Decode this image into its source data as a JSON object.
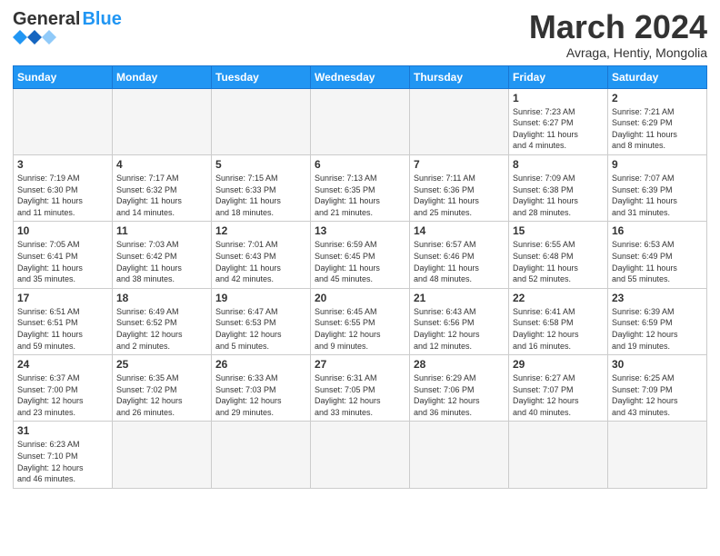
{
  "logo": {
    "general": "General",
    "blue": "Blue"
  },
  "header": {
    "month": "March 2024",
    "location": "Avraga, Hentiy, Mongolia"
  },
  "days": [
    "Sunday",
    "Monday",
    "Tuesday",
    "Wednesday",
    "Thursday",
    "Friday",
    "Saturday"
  ],
  "weeks": [
    [
      {
        "num": "",
        "info": ""
      },
      {
        "num": "",
        "info": ""
      },
      {
        "num": "",
        "info": ""
      },
      {
        "num": "",
        "info": ""
      },
      {
        "num": "",
        "info": ""
      },
      {
        "num": "1",
        "info": "Sunrise: 7:23 AM\nSunset: 6:27 PM\nDaylight: 11 hours\nand 4 minutes."
      },
      {
        "num": "2",
        "info": "Sunrise: 7:21 AM\nSunset: 6:29 PM\nDaylight: 11 hours\nand 8 minutes."
      }
    ],
    [
      {
        "num": "3",
        "info": "Sunrise: 7:19 AM\nSunset: 6:30 PM\nDaylight: 11 hours\nand 11 minutes."
      },
      {
        "num": "4",
        "info": "Sunrise: 7:17 AM\nSunset: 6:32 PM\nDaylight: 11 hours\nand 14 minutes."
      },
      {
        "num": "5",
        "info": "Sunrise: 7:15 AM\nSunset: 6:33 PM\nDaylight: 11 hours\nand 18 minutes."
      },
      {
        "num": "6",
        "info": "Sunrise: 7:13 AM\nSunset: 6:35 PM\nDaylight: 11 hours\nand 21 minutes."
      },
      {
        "num": "7",
        "info": "Sunrise: 7:11 AM\nSunset: 6:36 PM\nDaylight: 11 hours\nand 25 minutes."
      },
      {
        "num": "8",
        "info": "Sunrise: 7:09 AM\nSunset: 6:38 PM\nDaylight: 11 hours\nand 28 minutes."
      },
      {
        "num": "9",
        "info": "Sunrise: 7:07 AM\nSunset: 6:39 PM\nDaylight: 11 hours\nand 31 minutes."
      }
    ],
    [
      {
        "num": "10",
        "info": "Sunrise: 7:05 AM\nSunset: 6:41 PM\nDaylight: 11 hours\nand 35 minutes."
      },
      {
        "num": "11",
        "info": "Sunrise: 7:03 AM\nSunset: 6:42 PM\nDaylight: 11 hours\nand 38 minutes."
      },
      {
        "num": "12",
        "info": "Sunrise: 7:01 AM\nSunset: 6:43 PM\nDaylight: 11 hours\nand 42 minutes."
      },
      {
        "num": "13",
        "info": "Sunrise: 6:59 AM\nSunset: 6:45 PM\nDaylight: 11 hours\nand 45 minutes."
      },
      {
        "num": "14",
        "info": "Sunrise: 6:57 AM\nSunset: 6:46 PM\nDaylight: 11 hours\nand 48 minutes."
      },
      {
        "num": "15",
        "info": "Sunrise: 6:55 AM\nSunset: 6:48 PM\nDaylight: 11 hours\nand 52 minutes."
      },
      {
        "num": "16",
        "info": "Sunrise: 6:53 AM\nSunset: 6:49 PM\nDaylight: 11 hours\nand 55 minutes."
      }
    ],
    [
      {
        "num": "17",
        "info": "Sunrise: 6:51 AM\nSunset: 6:51 PM\nDaylight: 11 hours\nand 59 minutes."
      },
      {
        "num": "18",
        "info": "Sunrise: 6:49 AM\nSunset: 6:52 PM\nDaylight: 12 hours\nand 2 minutes."
      },
      {
        "num": "19",
        "info": "Sunrise: 6:47 AM\nSunset: 6:53 PM\nDaylight: 12 hours\nand 5 minutes."
      },
      {
        "num": "20",
        "info": "Sunrise: 6:45 AM\nSunset: 6:55 PM\nDaylight: 12 hours\nand 9 minutes."
      },
      {
        "num": "21",
        "info": "Sunrise: 6:43 AM\nSunset: 6:56 PM\nDaylight: 12 hours\nand 12 minutes."
      },
      {
        "num": "22",
        "info": "Sunrise: 6:41 AM\nSunset: 6:58 PM\nDaylight: 12 hours\nand 16 minutes."
      },
      {
        "num": "23",
        "info": "Sunrise: 6:39 AM\nSunset: 6:59 PM\nDaylight: 12 hours\nand 19 minutes."
      }
    ],
    [
      {
        "num": "24",
        "info": "Sunrise: 6:37 AM\nSunset: 7:00 PM\nDaylight: 12 hours\nand 23 minutes."
      },
      {
        "num": "25",
        "info": "Sunrise: 6:35 AM\nSunset: 7:02 PM\nDaylight: 12 hours\nand 26 minutes."
      },
      {
        "num": "26",
        "info": "Sunrise: 6:33 AM\nSunset: 7:03 PM\nDaylight: 12 hours\nand 29 minutes."
      },
      {
        "num": "27",
        "info": "Sunrise: 6:31 AM\nSunset: 7:05 PM\nDaylight: 12 hours\nand 33 minutes."
      },
      {
        "num": "28",
        "info": "Sunrise: 6:29 AM\nSunset: 7:06 PM\nDaylight: 12 hours\nand 36 minutes."
      },
      {
        "num": "29",
        "info": "Sunrise: 6:27 AM\nSunset: 7:07 PM\nDaylight: 12 hours\nand 40 minutes."
      },
      {
        "num": "30",
        "info": "Sunrise: 6:25 AM\nSunset: 7:09 PM\nDaylight: 12 hours\nand 43 minutes."
      }
    ],
    [
      {
        "num": "31",
        "info": "Sunrise: 6:23 AM\nSunset: 7:10 PM\nDaylight: 12 hours\nand 46 minutes."
      },
      {
        "num": "",
        "info": ""
      },
      {
        "num": "",
        "info": ""
      },
      {
        "num": "",
        "info": ""
      },
      {
        "num": "",
        "info": ""
      },
      {
        "num": "",
        "info": ""
      },
      {
        "num": "",
        "info": ""
      }
    ]
  ]
}
